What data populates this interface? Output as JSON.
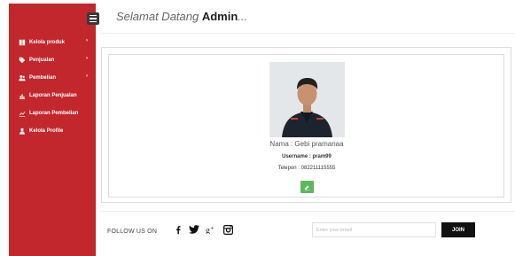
{
  "header": {
    "greeting": "Selamat Datang ",
    "user": "Admin",
    "suffix": "..."
  },
  "sidebar": {
    "toggle_icon": "menu-icon",
    "items": [
      {
        "label": "Kelola produk",
        "icon": "book-icon",
        "has_submenu": true
      },
      {
        "label": "Penjualan",
        "icon": "tag-icon",
        "has_submenu": true
      },
      {
        "label": "Pembelian",
        "icon": "users-icon",
        "has_submenu": true
      },
      {
        "label": "Laporan Penjualan",
        "icon": "bar-chart-icon",
        "has_submenu": false
      },
      {
        "label": "Laporan Pembelian",
        "icon": "line-chart-icon",
        "has_submenu": false
      },
      {
        "label": "Kelola Profile",
        "icon": "user-icon",
        "has_submenu": false
      }
    ],
    "chevron": "›",
    "background": "#c1272d"
  },
  "profile": {
    "name": "Nama : Gebi pramanaa",
    "username": "Username : pram99",
    "phone": "Telepon : 082211115555",
    "edit_icon": "edit-icon",
    "edit_color": "#5cb85c"
  },
  "footer": {
    "follow_label": "FOLLOW US ON",
    "social": [
      "facebook-icon",
      "twitter-icon",
      "google-plus-icon",
      "instagram-icon"
    ],
    "email_placeholder": "Enter your email",
    "join_label": "JOIN"
  }
}
